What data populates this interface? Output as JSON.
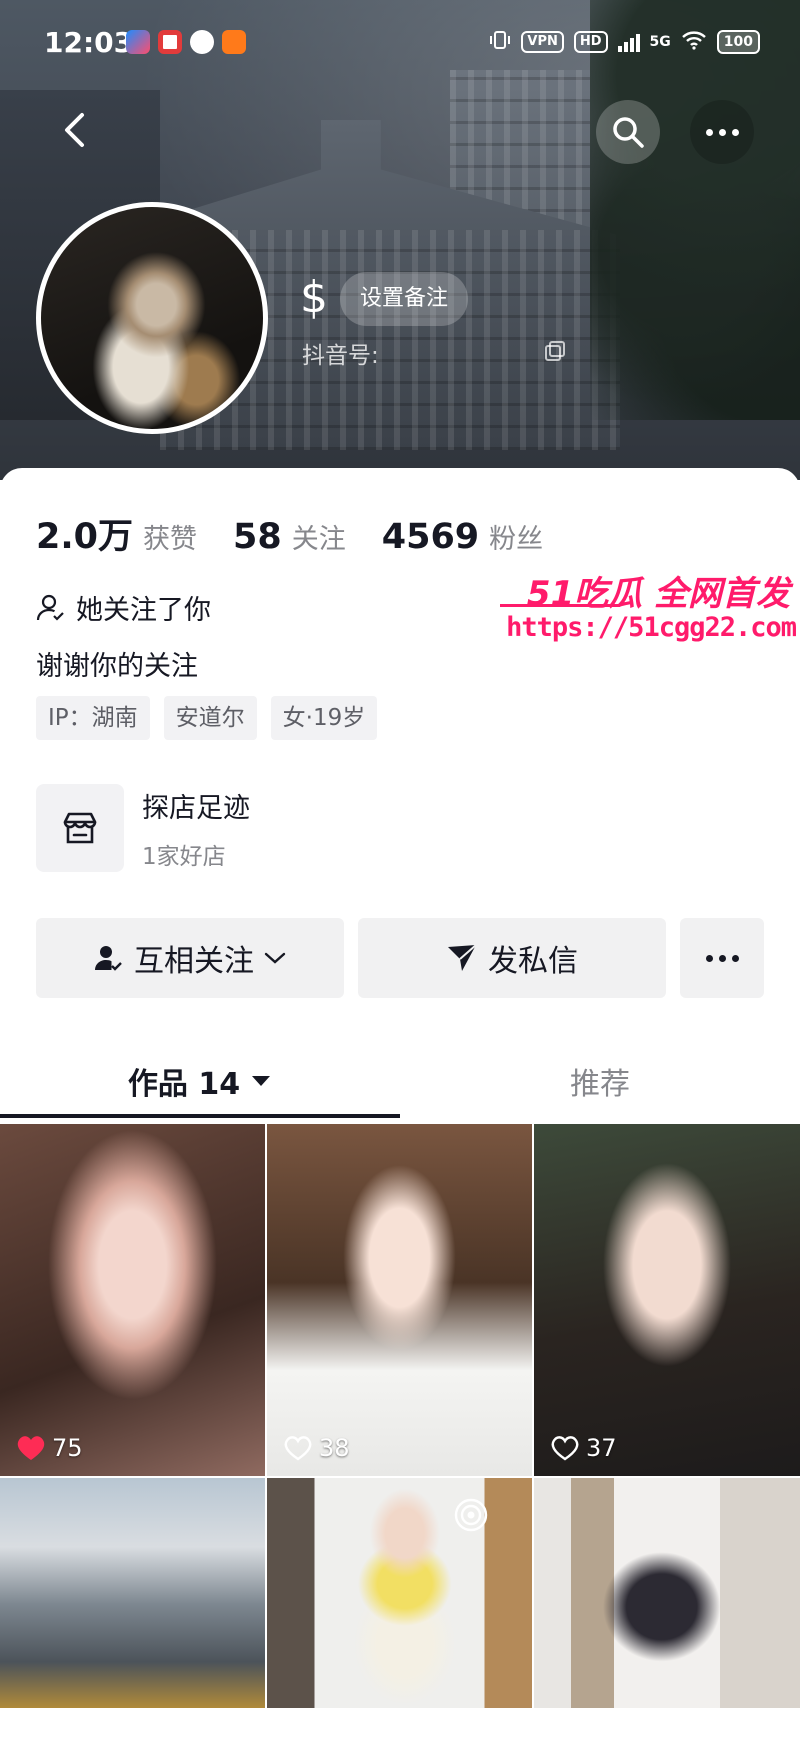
{
  "status_bar": {
    "time": "12:03",
    "vpn": "VPN",
    "hd": "HD",
    "network": "5G",
    "battery": "100"
  },
  "header": {
    "remark_button": "设置备注",
    "douyin_id_label": "抖音号:"
  },
  "profile": {
    "stats": [
      {
        "value": "2.0万",
        "label": "获赞"
      },
      {
        "value": "58",
        "label": "关注"
      },
      {
        "value": "4569",
        "label": "粉丝"
      }
    ],
    "follows_you": "她关注了你",
    "bio": "谢谢你的关注",
    "tags": [
      "IP：湖南",
      "安道尔",
      "女·19岁"
    ]
  },
  "shop": {
    "title": "探店足迹",
    "subtitle": "1家好店"
  },
  "actions": {
    "follow_label": "互相关注",
    "message_label": "发私信"
  },
  "tabs": {
    "works_label": "作品 14",
    "recommend_label": "推荐"
  },
  "videos": [
    {
      "likes": "75"
    },
    {
      "likes": "38"
    },
    {
      "likes": "37"
    }
  ],
  "watermark": {
    "brand": "51吃瓜 全网首发",
    "url": "https://51cgg22.com"
  },
  "colors": {
    "accent": "#ff1b6b",
    "liked_heart": "#fe2c55"
  }
}
